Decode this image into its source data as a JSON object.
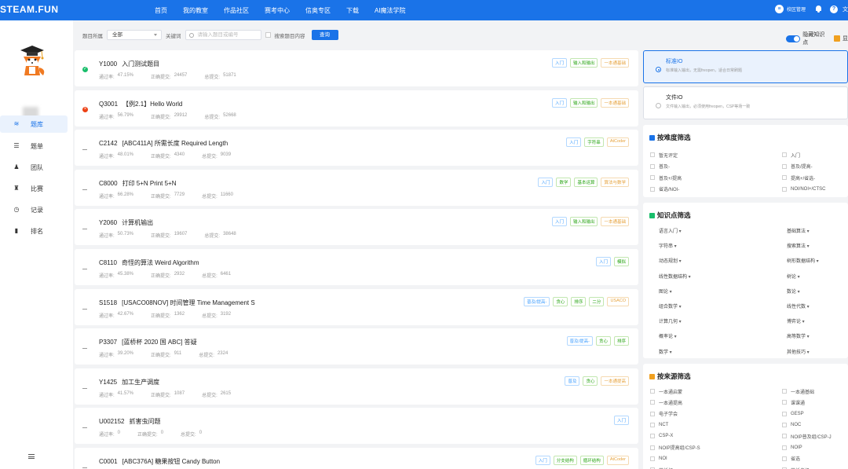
{
  "brand": "STEAM.FUN",
  "nav": [
    "首页",
    "我的教室",
    "作品社区",
    "赛考中心",
    "信奥专区",
    "下载",
    "AI魔法学院"
  ],
  "topright": {
    "admin": "校区管理",
    "lang": "文"
  },
  "sidebar": [
    {
      "label": "题库",
      "icon": "layers-icon",
      "active": true
    },
    {
      "label": "题单",
      "icon": "list-icon",
      "active": false
    },
    {
      "label": "团队",
      "icon": "team-icon",
      "active": false
    },
    {
      "label": "比赛",
      "icon": "trophy-icon",
      "active": false
    },
    {
      "label": "记录",
      "icon": "clock-icon",
      "active": false
    },
    {
      "label": "排名",
      "icon": "bar-chart-icon",
      "active": false
    }
  ],
  "filter": {
    "belong_label": "题目所属",
    "belong_value": "全部",
    "keyword_label": "关键词",
    "search_placeholder": "请输入题目或编号",
    "search_content_label": "搜索题目内容",
    "query_button": "查询",
    "hide_knowledge_label": "隐藏知识点",
    "extra_label": "显"
  },
  "problems": [
    {
      "id": "Y1000",
      "title": "入门测试题目",
      "status": "ok",
      "pass_label": "通过率:",
      "pass": "47.15%",
      "correct_label": "正确提交:",
      "correct": "24457",
      "total_label": "总提交:",
      "total": "51871",
      "tags": [
        [
          "入门",
          "blue"
        ],
        [
          "输入和输出",
          "green"
        ],
        [
          "一本通基础",
          "orange"
        ]
      ]
    },
    {
      "id": "Q3001",
      "title": "【例2.1】Hello World",
      "status": "err",
      "pass_label": "通过率:",
      "pass": "56.79%",
      "correct_label": "正确提交:",
      "correct": "29912",
      "total_label": "总提交:",
      "total": "52668",
      "tags": [
        [
          "入门",
          "blue"
        ],
        [
          "输入和输出",
          "green"
        ],
        [
          "一本通基础",
          "orange"
        ]
      ]
    },
    {
      "id": "C2142",
      "title": "[ABC411A] 所需长度 Required Length",
      "status": "none",
      "pass_label": "通过率:",
      "pass": "48.01%",
      "correct_label": "正确提交:",
      "correct": "4340",
      "total_label": "总提交:",
      "total": "9039",
      "tags": [
        [
          "入门",
          "blue"
        ],
        [
          "字符串",
          "green"
        ],
        [
          "AtCoder",
          "orange"
        ]
      ]
    },
    {
      "id": "C8000",
      "title": "打印 5+N Print 5+N",
      "status": "none",
      "pass_label": "通过率:",
      "pass": "66.28%",
      "correct_label": "正确提交:",
      "correct": "7729",
      "total_label": "总提交:",
      "total": "11660",
      "tags": [
        [
          "入门",
          "blue"
        ],
        [
          "数学",
          "green"
        ],
        [
          "基本运算",
          "green"
        ],
        [
          "算法与数学",
          "orange"
        ]
      ]
    },
    {
      "id": "Y2060",
      "title": "计算机输出",
      "status": "none",
      "pass_label": "通过率:",
      "pass": "50.73%",
      "correct_label": "正确提交:",
      "correct": "19607",
      "total_label": "总提交:",
      "total": "38648",
      "tags": [
        [
          "入门",
          "blue"
        ],
        [
          "输入和输出",
          "green"
        ],
        [
          "一本通基础",
          "orange"
        ]
      ]
    },
    {
      "id": "C8110",
      "title": "奇怪的算法 Weird Algorithm",
      "status": "none",
      "pass_label": "通过率:",
      "pass": "45.38%",
      "correct_label": "正确提交:",
      "correct": "2932",
      "total_label": "总提交:",
      "total": "6461",
      "tags": [
        [
          "入门",
          "blue"
        ],
        [
          "模拟",
          "green"
        ]
      ]
    },
    {
      "id": "S1518",
      "title": "[USACO08NOV] 时间管理 Time Management S",
      "status": "none",
      "pass_label": "通过率:",
      "pass": "42.67%",
      "correct_label": "正确提交:",
      "correct": "1362",
      "total_label": "总提交:",
      "total": "3192",
      "tags": [
        [
          "普及/提高-",
          "blue"
        ],
        [
          "贪心",
          "green"
        ],
        [
          "排序",
          "green"
        ],
        [
          "二分",
          "green"
        ],
        [
          "USACO",
          "orange"
        ]
      ]
    },
    {
      "id": "P3307",
      "title": "[蓝桥杯 2020 国 ABC] 答疑",
      "status": "none",
      "pass_label": "通过率:",
      "pass": "39.20%",
      "correct_label": "正确提交:",
      "correct": "911",
      "total_label": "总提交:",
      "total": "2324",
      "tags": [
        [
          "普及/提高-",
          "blue"
        ],
        [
          "贪心",
          "green"
        ],
        [
          "排序",
          "green"
        ]
      ]
    },
    {
      "id": "Y1425",
      "title": "加工生产调度",
      "status": "none",
      "pass_label": "通过率:",
      "pass": "41.57%",
      "correct_label": "正确提交:",
      "correct": "1087",
      "total_label": "总提交:",
      "total": "2615",
      "tags": [
        [
          "普及",
          "blue"
        ],
        [
          "贪心",
          "green"
        ],
        [
          "一本通提高",
          "orange"
        ]
      ]
    },
    {
      "id": "U002152",
      "title": "抓害虫问题",
      "status": "none",
      "pass_label": "通过率:",
      "pass": "0",
      "correct_label": "正确提交:",
      "correct": "0",
      "total_label": "总提交:",
      "total": "0",
      "tags": [
        [
          "入门",
          "blue"
        ]
      ]
    },
    {
      "id": "C0001",
      "title": "[ABC376A] 糖果按钮 Candy Button",
      "status": "none",
      "pass_label": "通过率:",
      "pass": "",
      "correct_label": "正确提交:",
      "correct": "",
      "total_label": "总提交:",
      "total": "",
      "tags": [
        [
          "入门",
          "blue"
        ],
        [
          "分支结构",
          "green"
        ],
        [
          "循环结构",
          "green"
        ],
        [
          "AtCoder",
          "orange"
        ]
      ]
    }
  ],
  "io": [
    {
      "title": "标准IO",
      "desc": "标准输入输出，无需freopen，适合日常刷题",
      "active": true
    },
    {
      "title": "文件IO",
      "desc": "文件输入输出，必须使用freopen，CSP等场一致",
      "active": false
    }
  ],
  "difficulty": {
    "title": "按难度筛选",
    "color": "#1a73e8",
    "items": [
      "暂无评定",
      "入门",
      "普及-",
      "普及/提高-",
      "普及+/提高",
      "提高+/省选-",
      "省选/NOI-",
      "NOI/NOI+/CTSC"
    ]
  },
  "knowledge": {
    "title": "知识点筛选",
    "color": "#19be6b",
    "items": [
      "语言入门",
      "基础算法",
      "字符串",
      "搜索算法",
      "动态规划",
      "树形数据结构",
      "线性数据结构",
      "树论",
      "图论",
      "数论",
      "组合数学",
      "线性代数",
      "计算几何",
      "博弈论",
      "概率论",
      "高等数学",
      "数学",
      "其他技巧"
    ]
  },
  "source": {
    "title": "按来源筛选",
    "color": "#f0a020",
    "items": [
      "一本通启蒙",
      "一本通基础",
      "一本通提高",
      "课课通",
      "电子学会",
      "GESP",
      "NCT",
      "NOC",
      "CSP-X",
      "NOIP普及组/CSP-J",
      "NOIP提高组/CSP-S",
      "NOIP",
      "NOI",
      "省选",
      "蓝桥杯",
      "蓝桥考级"
    ]
  }
}
